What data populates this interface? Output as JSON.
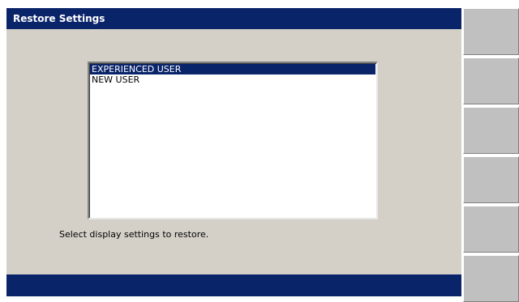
{
  "dialog": {
    "title": "Restore Settings",
    "list": {
      "items": [
        {
          "label": "EXPERIENCED USER",
          "selected": true
        },
        {
          "label": "NEW USER",
          "selected": false
        }
      ]
    },
    "instruction": "Select display settings to restore."
  },
  "softkeys": [
    {
      "label": ""
    },
    {
      "label": ""
    },
    {
      "label": ""
    },
    {
      "label": ""
    },
    {
      "label": ""
    },
    {
      "label": ""
    }
  ],
  "colors": {
    "titlebar": "#0a246a",
    "dialog_bg": "#d4d0c8",
    "selection": "#0a246a",
    "softkey": "#c0c0c0"
  }
}
